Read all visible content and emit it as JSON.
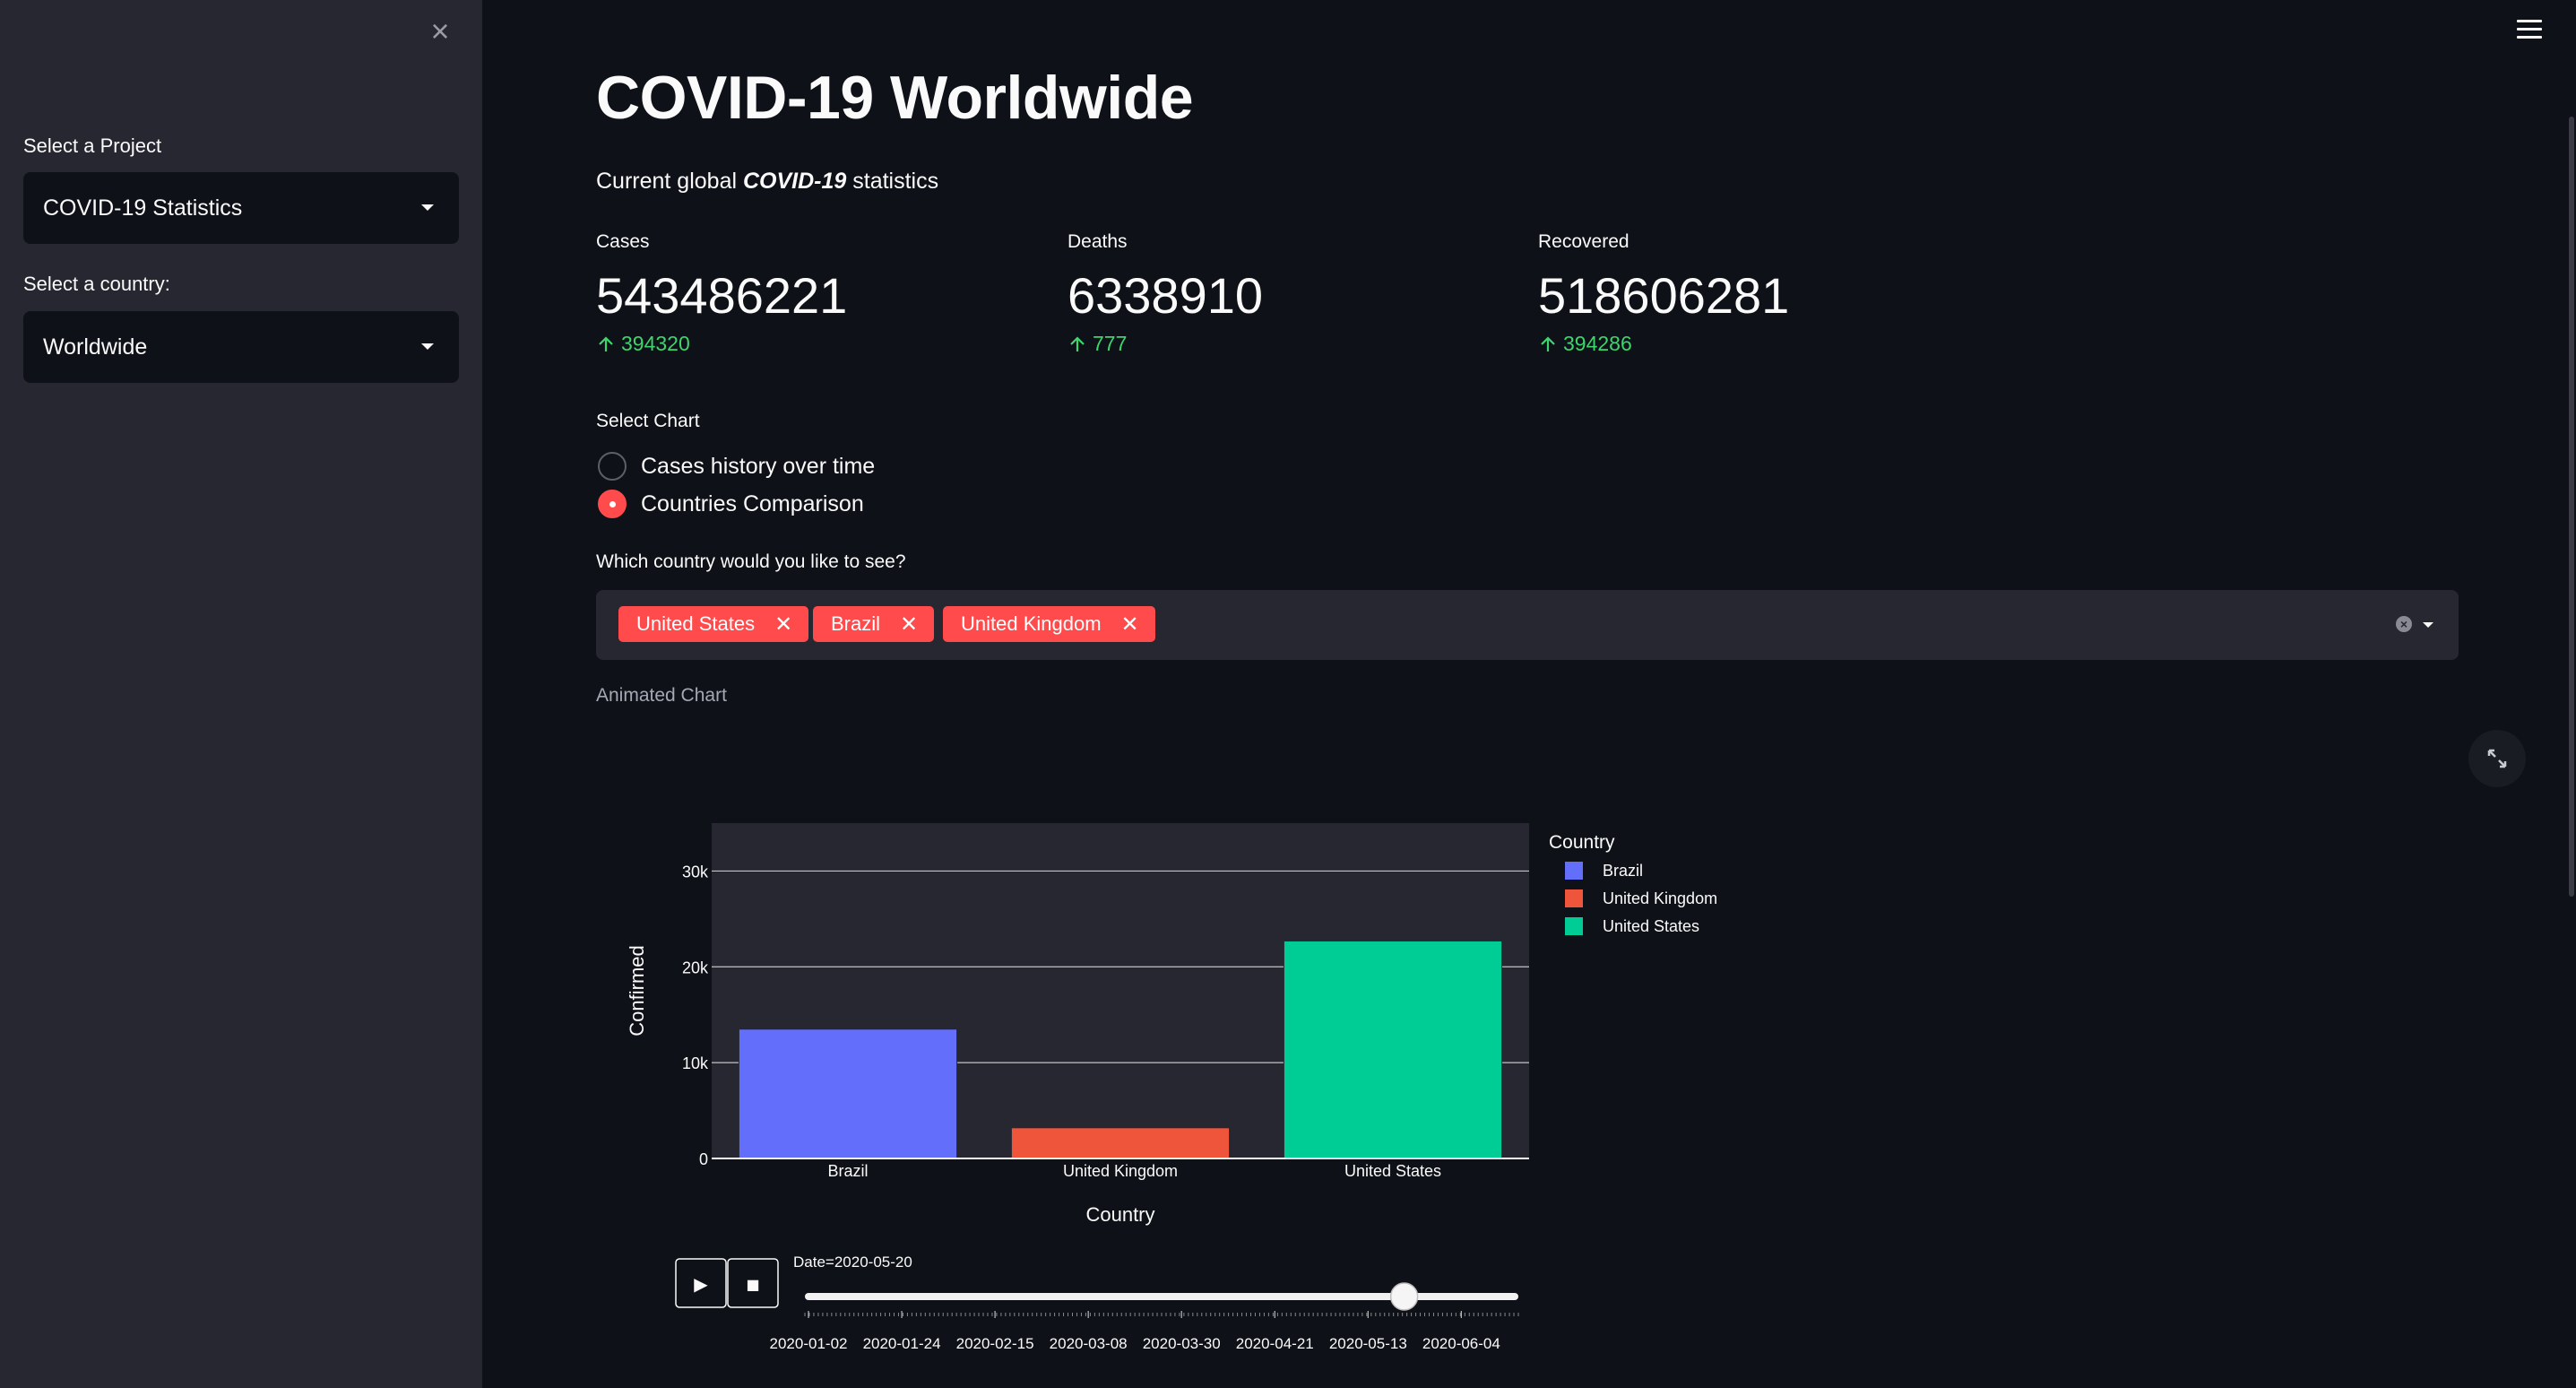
{
  "sidebar": {
    "close_icon": "×",
    "project_label": "Select a Project",
    "project_value": "COVID-19 Statistics",
    "country_label": "Select a country:",
    "country_value": "Worldwide"
  },
  "main": {
    "title": "COVID-19 Worldwide",
    "subtitle_prefix": "Current global ",
    "subtitle_bold": "COVID-19",
    "subtitle_suffix": " statistics",
    "metrics": [
      {
        "label": "Cases",
        "value": "543486221",
        "delta": "394320"
      },
      {
        "label": "Deaths",
        "value": "6338910",
        "delta": "777"
      },
      {
        "label": "Recovered",
        "value": "518606281",
        "delta": "394286"
      }
    ],
    "select_chart_label": "Select Chart",
    "radio_options": [
      {
        "label": "Cases history over time",
        "selected": false
      },
      {
        "label": "Countries Comparison",
        "selected": true
      }
    ],
    "which_country_label": "Which country would you like to see?",
    "selected_countries": [
      "United States",
      "Brazil",
      "United Kingdom"
    ],
    "tag_remove_icon": "✕",
    "animated_chart_label": "Animated Chart"
  },
  "colors": {
    "accent": "#ff4b4b",
    "delta_green": "#3dd56d",
    "brazil": "#636efa",
    "united_kingdom": "#ef553b",
    "united_states": "#00cc96"
  },
  "chart_data": {
    "type": "bar",
    "title": "",
    "xlabel": "Country",
    "ylabel": "Confirmed",
    "categories": [
      "Brazil",
      "United Kingdom",
      "United States"
    ],
    "values": [
      13500,
      3200,
      22700
    ],
    "colors": [
      "#636efa",
      "#ef553b",
      "#00cc96"
    ],
    "ylim": [
      0,
      35000
    ],
    "yticks": [
      0,
      10000,
      20000,
      30000
    ],
    "ytick_labels": [
      "0",
      "10k",
      "20k",
      "30k"
    ],
    "legend_title": "Country",
    "legend_placement": "right",
    "legend_entries": [
      "Brazil",
      "United Kingdom",
      "United States"
    ],
    "grid": true,
    "animation": {
      "current_label": "Date=2020-05-20",
      "slider_fraction": 0.84,
      "date_ticks": [
        "2020-01-02",
        "2020-01-24",
        "2020-02-15",
        "2020-03-08",
        "2020-03-30",
        "2020-04-21",
        "2020-05-13",
        "2020-06-04"
      ],
      "play_icon": "▶",
      "stop_icon": "■"
    }
  }
}
